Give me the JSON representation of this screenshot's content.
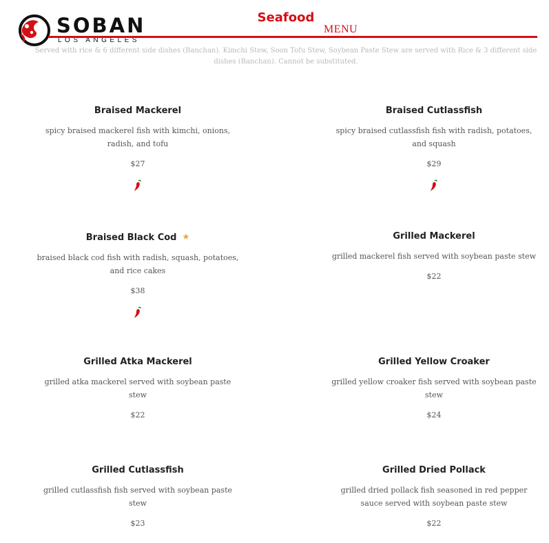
{
  "header": {
    "brand": "SOBAN",
    "brand_sub": "LOS ANGELES",
    "title": "Seafood",
    "menu_label": "MENU",
    "notice": "Served with rice & 6 different side dishes (Banchan). Kimchi Stew, Soon Tofu Stew, Soybean Paste Stew are served with Rice & 3 different side dishes (Banchan). Cannot be substituted."
  },
  "colors": {
    "accent": "#d21016",
    "star": "#e0a24f"
  },
  "items": [
    {
      "name": "Braised Mackerel",
      "description": "spicy braised mackerel fish with kimchi, onions, radish, and tofu",
      "price": "$27",
      "spicy": true,
      "featured": false
    },
    {
      "name": "Braised Cutlassfish",
      "description": "spicy braised cutlassfish fish with radish, potatoes, and squash",
      "price": "$29",
      "spicy": true,
      "featured": false
    },
    {
      "name": "Braised Black Cod",
      "description": "braised black cod fish with radish, squash, potatoes, and rice cakes",
      "price": "$38",
      "spicy": true,
      "featured": true
    },
    {
      "name": "Grilled Mackerel",
      "description": "grilled mackerel fish served with soybean paste stew",
      "price": "$22",
      "spicy": false,
      "featured": false
    },
    {
      "name": "Grilled Atka Mackerel",
      "description": "grilled atka mackerel served with soybean paste stew",
      "price": "$22",
      "spicy": false,
      "featured": false
    },
    {
      "name": "Grilled Yellow Croaker",
      "description": "grilled yellow croaker fish served with soybean paste stew",
      "price": "$24",
      "spicy": false,
      "featured": false
    },
    {
      "name": "Grilled Cutlassfish",
      "description": "grilled cutlassfish fish served with soybean paste stew",
      "price": "$23",
      "spicy": false,
      "featured": false
    },
    {
      "name": "Grilled Dried Pollack",
      "description": "grilled dried pollack fish seasoned in red pepper sauce served with soybean paste stew",
      "price": "$22",
      "spicy": false,
      "featured": false
    }
  ],
  "icons": {
    "spicy": "chili-pepper-icon",
    "featured": "star-icon",
    "logo": "soban-logo-mark"
  }
}
